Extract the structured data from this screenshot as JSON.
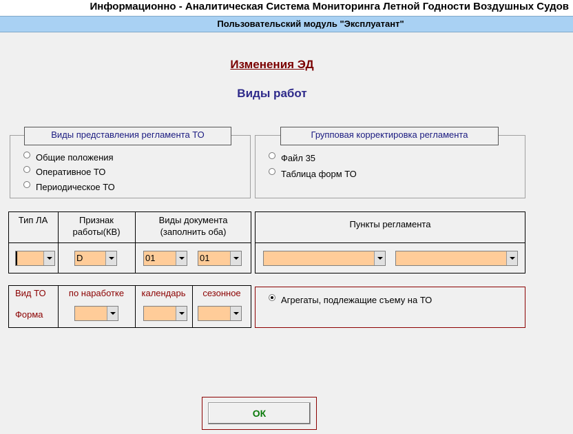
{
  "header": {
    "title": "Информационно - Аналитическая Система Мониторинга Летной Годности Воздушных Судов",
    "subtitle": "Пользовательский модуль \"Эксплуатант\""
  },
  "main": {
    "heading": "Изменения ЭД",
    "subheading": "Виды работ"
  },
  "regulation_views": {
    "legend": "Виды представления регламента ТО",
    "options": [
      {
        "label": "Общие положения",
        "selected": false
      },
      {
        "label": "Оперативное ТО",
        "selected": false
      },
      {
        "label": "Периодическое ТО",
        "selected": false
      }
    ]
  },
  "group_correction": {
    "legend": "Групповая корректировка регламента",
    "options": [
      {
        "label": "Файл 35",
        "selected": false
      },
      {
        "label": "Таблица форм ТО",
        "selected": false
      }
    ]
  },
  "filters": {
    "aircraft_type_label": "Тип ЛА",
    "aircraft_type_value": "",
    "work_sign_label_1": "Признак",
    "work_sign_label_2": "работы(КВ)",
    "work_sign_value": "D",
    "doc_types_label_1": "Виды  документа",
    "doc_types_label_2": "(заполнить оба)",
    "doc_type_1_value": "01",
    "doc_type_2_value": "01",
    "reg_items_label": "Пункты  регламента",
    "reg_item_1_value": "",
    "reg_item_2_value": ""
  },
  "to_form": {
    "vid_to_label": "Вид ТО",
    "forma_label": "Форма",
    "by_hours_label": "по наработке",
    "calendar_label": "календарь",
    "seasonal_label": "сезонное",
    "by_hours_value": "",
    "calendar_value": "",
    "seasonal_value": ""
  },
  "aggregates": {
    "label": "Агрегаты, подлежащие съему на ТО",
    "selected": true
  },
  "actions": {
    "ok_label": "ОК"
  },
  "colors": {
    "combo_bg": "#ffcc99",
    "header_bg": "#a9d1f3",
    "heading": "#7a0000",
    "subheading": "#2e2a8a",
    "ok_text": "#0a7a0a"
  }
}
